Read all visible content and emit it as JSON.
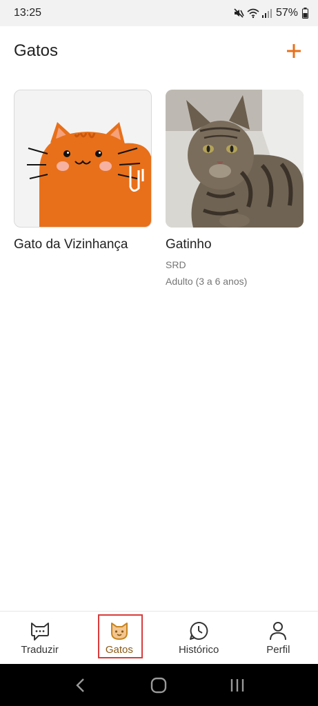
{
  "status_bar": {
    "time": "13:25",
    "battery": "57%"
  },
  "header": {
    "title": "Gatos",
    "add_icon": "plus-icon"
  },
  "accent_color": "#e8701a",
  "cats": [
    {
      "name": "Gato da Vizinhança",
      "breed": "",
      "age": ""
    },
    {
      "name": "Gatinho",
      "breed": "SRD",
      "age": "Adulto (3 a 6 anos)"
    }
  ],
  "bottom_nav": {
    "items": [
      {
        "label": "Traduzir",
        "icon": "chat-cat-icon"
      },
      {
        "label": "Gatos",
        "icon": "cat-face-icon",
        "active": true
      },
      {
        "label": "Histórico",
        "icon": "clock-icon"
      },
      {
        "label": "Perfil",
        "icon": "person-icon"
      }
    ]
  },
  "system_nav": {
    "back": "back-icon",
    "home": "home-icon",
    "recents": "recents-icon"
  }
}
